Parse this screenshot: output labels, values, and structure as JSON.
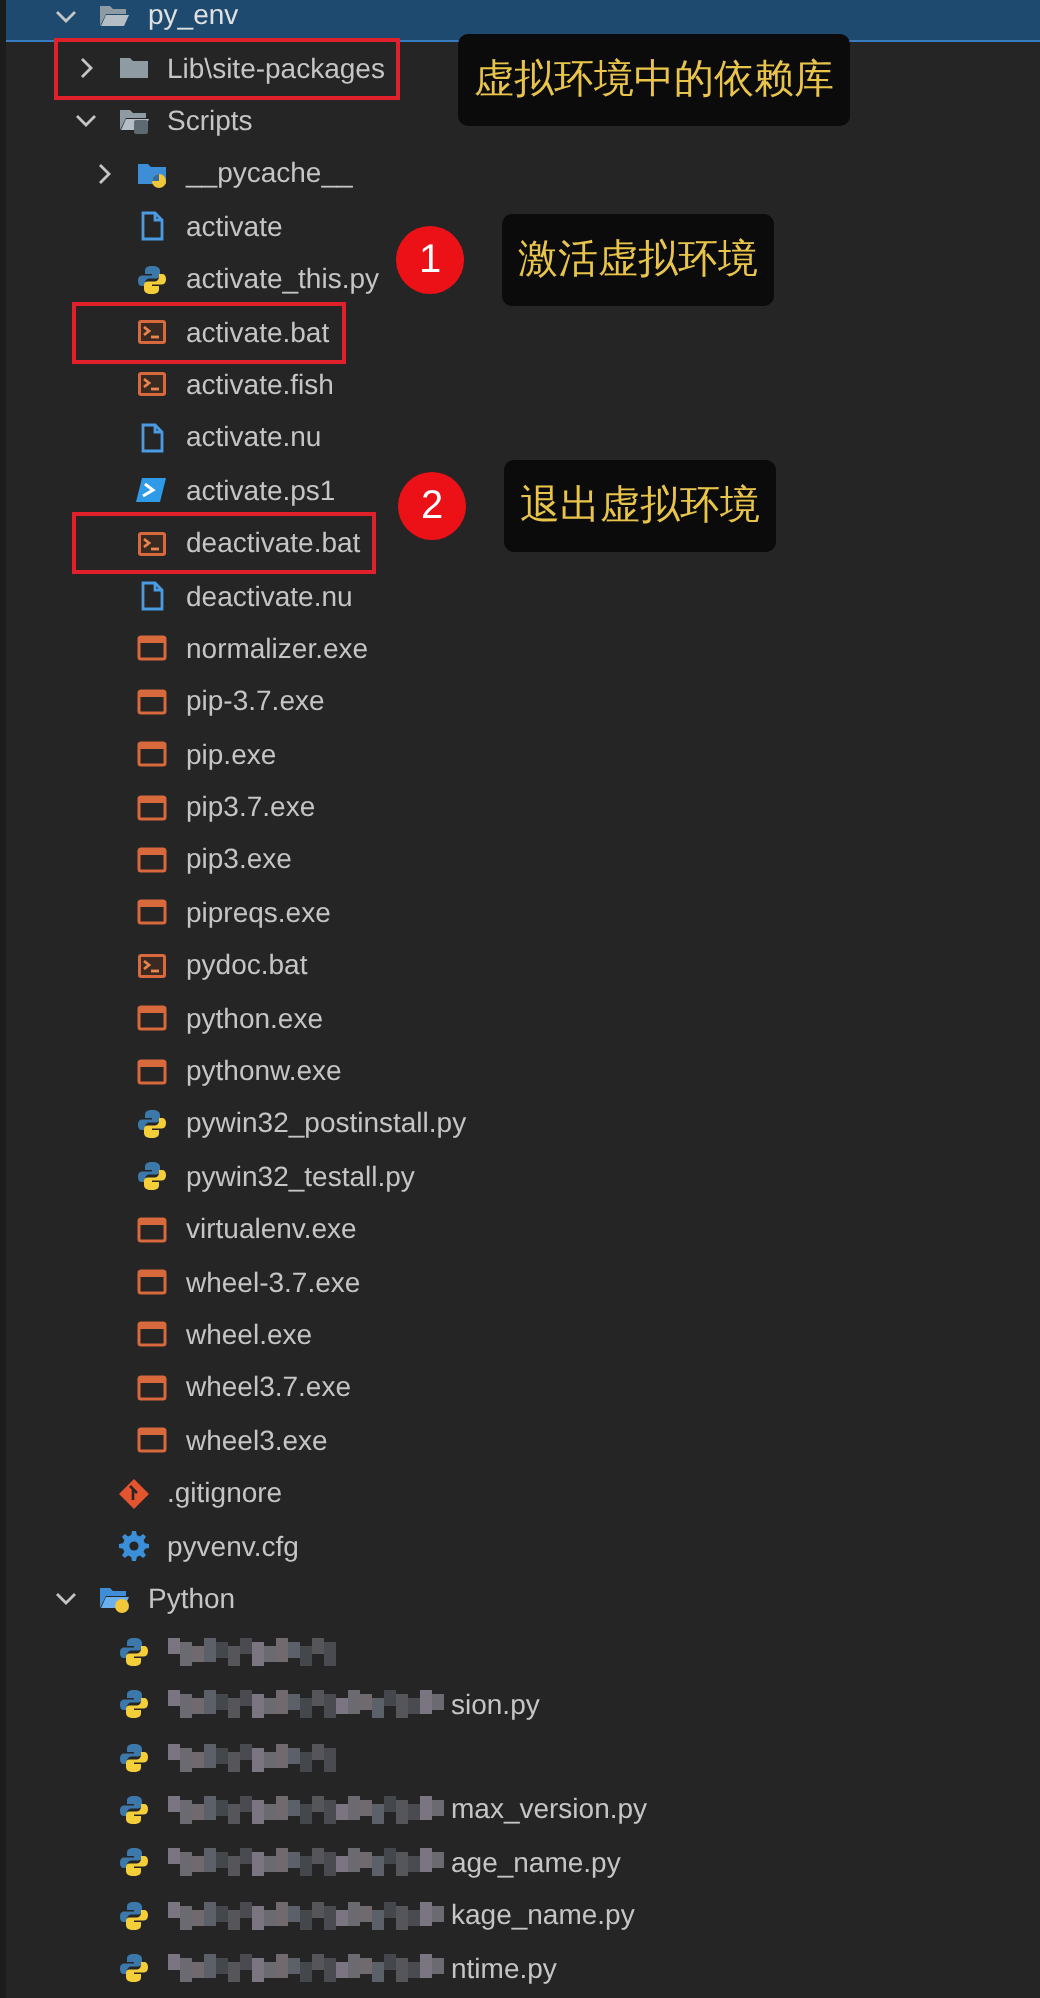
{
  "tree": [
    {
      "name": "py_env",
      "kind": "folder-open",
      "expanded": true,
      "selected": true,
      "highlighted": false,
      "children": [
        {
          "name": "Lib\\site-packages",
          "kind": "folder",
          "expanded": false,
          "selected": false,
          "highlighted": true
        },
        {
          "name": "Scripts",
          "kind": "folder-scripts",
          "expanded": true,
          "selected": false,
          "highlighted": false,
          "children": [
            {
              "name": "__pycache__",
              "kind": "folder-python",
              "expanded": false,
              "selected": false,
              "highlighted": false
            },
            {
              "name": "activate",
              "kind": "file",
              "selected": false,
              "highlighted": false
            },
            {
              "name": "activate_this.py",
              "kind": "python",
              "selected": false,
              "highlighted": false
            },
            {
              "name": "activate.bat",
              "kind": "terminal",
              "selected": false,
              "highlighted": true
            },
            {
              "name": "activate.fish",
              "kind": "terminal",
              "selected": false,
              "highlighted": false
            },
            {
              "name": "activate.nu",
              "kind": "file",
              "selected": false,
              "highlighted": false
            },
            {
              "name": "activate.ps1",
              "kind": "powershell",
              "selected": false,
              "highlighted": false
            },
            {
              "name": "deactivate.bat",
              "kind": "terminal",
              "selected": false,
              "highlighted": true
            },
            {
              "name": "deactivate.nu",
              "kind": "file",
              "selected": false,
              "highlighted": false
            },
            {
              "name": "normalizer.exe",
              "kind": "exe",
              "selected": false,
              "highlighted": false
            },
            {
              "name": "pip-3.7.exe",
              "kind": "exe",
              "selected": false,
              "highlighted": false
            },
            {
              "name": "pip.exe",
              "kind": "exe",
              "selected": false,
              "highlighted": false
            },
            {
              "name": "pip3.7.exe",
              "kind": "exe",
              "selected": false,
              "highlighted": false
            },
            {
              "name": "pip3.exe",
              "kind": "exe",
              "selected": false,
              "highlighted": false
            },
            {
              "name": "pipreqs.exe",
              "kind": "exe",
              "selected": false,
              "highlighted": false
            },
            {
              "name": "pydoc.bat",
              "kind": "terminal",
              "selected": false,
              "highlighted": false
            },
            {
              "name": "python.exe",
              "kind": "exe",
              "selected": false,
              "highlighted": false
            },
            {
              "name": "pythonw.exe",
              "kind": "exe",
              "selected": false,
              "highlighted": false
            },
            {
              "name": "pywin32_postinstall.py",
              "kind": "python",
              "selected": false,
              "highlighted": false
            },
            {
              "name": "pywin32_testall.py",
              "kind": "python",
              "selected": false,
              "highlighted": false
            },
            {
              "name": "virtualenv.exe",
              "kind": "exe",
              "selected": false,
              "highlighted": false
            },
            {
              "name": "wheel-3.7.exe",
              "kind": "exe",
              "selected": false,
              "highlighted": false
            },
            {
              "name": "wheel.exe",
              "kind": "exe",
              "selected": false,
              "highlighted": false
            },
            {
              "name": "wheel3.7.exe",
              "kind": "exe",
              "selected": false,
              "highlighted": false
            },
            {
              "name": "wheel3.exe",
              "kind": "exe",
              "selected": false,
              "highlighted": false
            }
          ]
        },
        {
          "name": ".gitignore",
          "kind": "git",
          "selected": false,
          "highlighted": false
        },
        {
          "name": "pyvenv.cfg",
          "kind": "gear",
          "selected": false,
          "highlighted": false
        }
      ]
    },
    {
      "name": "Python",
      "kind": "folder-python-open",
      "expanded": true,
      "selected": false,
      "highlighted": false,
      "children": [
        {
          "kind": "python",
          "selected": false,
          "highlighted": false,
          "redacted": true
        },
        {
          "name": "sion.py",
          "kind": "python",
          "selected": false,
          "highlighted": false,
          "redacted": true
        },
        {
          "kind": "python",
          "selected": false,
          "highlighted": false,
          "redacted": true
        },
        {
          "name": "max_version.py",
          "kind": "python",
          "selected": false,
          "highlighted": false,
          "redacted": true
        },
        {
          "name": "age_name.py",
          "kind": "python",
          "selected": false,
          "highlighted": false,
          "redacted": true
        },
        {
          "name": "kage_name.py",
          "kind": "python",
          "selected": false,
          "highlighted": false,
          "redacted": true
        },
        {
          "name": "ntime.py",
          "kind": "python",
          "selected": false,
          "highlighted": false,
          "redacted": true
        }
      ]
    }
  ],
  "annotations": [
    {
      "text": "虚拟环境中的依赖库"
    },
    {
      "number": "1",
      "text": "激活虚拟环境"
    },
    {
      "number": "2",
      "text": "退出虚拟环境"
    }
  ]
}
